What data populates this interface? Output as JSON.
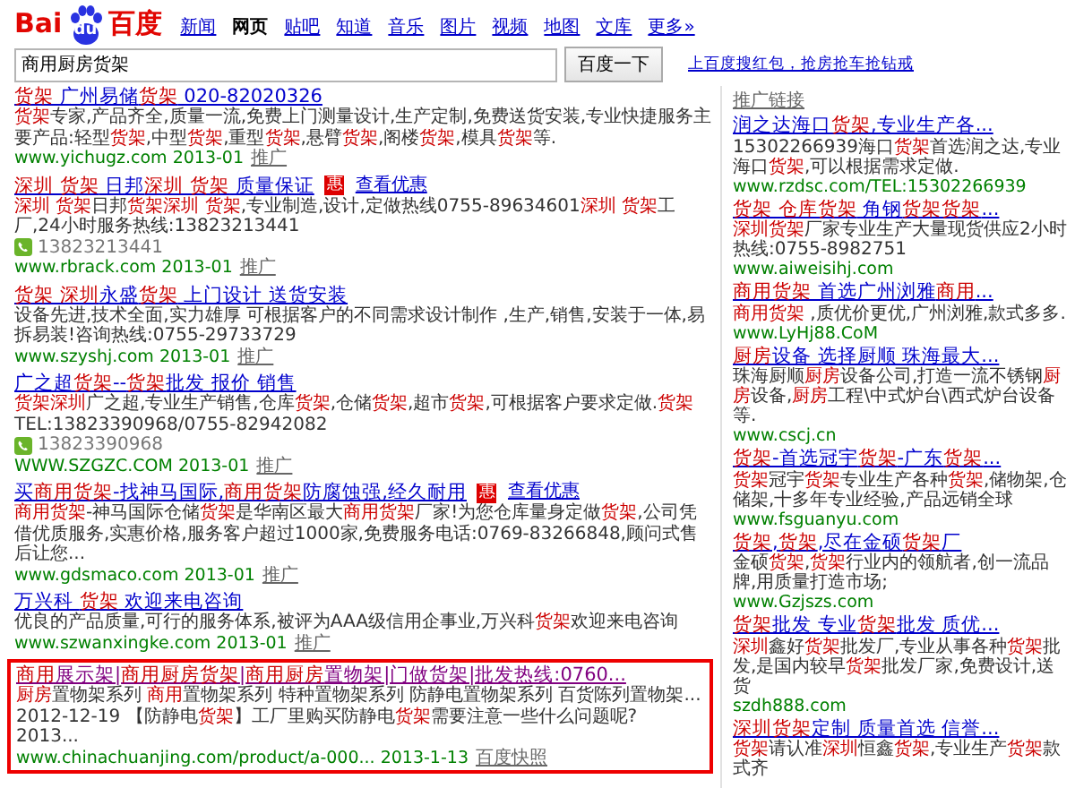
{
  "logo": {
    "left": "Bai",
    "paw": "du",
    "right": "百度"
  },
  "nav": [
    {
      "label": "新闻",
      "selected": false
    },
    {
      "label": "网页",
      "selected": true
    },
    {
      "label": "贴吧",
      "selected": false
    },
    {
      "label": "知道",
      "selected": false
    },
    {
      "label": "音乐",
      "selected": false
    },
    {
      "label": "图片",
      "selected": false
    },
    {
      "label": "视频",
      "selected": false
    },
    {
      "label": "地图",
      "selected": false
    },
    {
      "label": "文库",
      "selected": false
    },
    {
      "label": "更多»",
      "selected": false
    }
  ],
  "search": {
    "value": "商用厨房货架",
    "button": "百度一下",
    "promo": "上百度搜红包，抢房抢车抢钻戒"
  },
  "results": [
    {
      "title": "**货架** 广州易储**货架** 020-82020326",
      "desc": "**货架**专家,产品齐全,质量一流,免费上门测量设计,生产定制,免费送货安装,专业快捷服务主要产品:轻型**货架**,中型**货架**,重型**货架**,悬臂**货架**,阁楼**货架**,模具**货架**等.",
      "url": "www.yichugz.com 2013-01",
      "tag": "推广",
      "visited": false,
      "boxed": false
    },
    {
      "title": "**深圳 货架** 日邦**深圳 货架** 质量保证",
      "offer": {
        "badge": "惠",
        "label": "查看优惠"
      },
      "desc": "**深圳 货架**日邦**货架深圳 货架**,专业制造,设计,定做热线0755-89634601**深圳 货架**工厂,24小时服务热线:13823213441",
      "phone": "13823213441",
      "url": "www.rbrack.com 2013-01",
      "tag": "推广",
      "visited": false,
      "boxed": false
    },
    {
      "title": "**货架 深圳**永盛**货架** 上门设计 送货安装",
      "desc": "设备先进,技术全面,实力雄厚 可根据客户的不同需求设计制作 ,生产,销售,安装于一体,易拆易装!咨询热线:0755-29733729",
      "url": "www.szyshj.com 2013-01",
      "tag": "推广",
      "visited": false,
      "boxed": false
    },
    {
      "title": "广之超**货架**--**货架**批发 报价 销售",
      "desc": "**货架深圳**广之超,专业生产销售,仓库**货架**,仓储**货架**,超市**货架**,可根据客户要求定做.**货架**TEL:13823390968/0755-82942082",
      "phone": "13823390968",
      "url": "WWW.SZGZC.COM 2013-01",
      "tag": "推广",
      "visited": false,
      "boxed": false
    },
    {
      "title": "买**商用货架**-找神马国际,**商用货架**防腐蚀强,经久耐用",
      "offer": {
        "badge": "惠",
        "label": "查看优惠"
      },
      "desc": "**商用货架**-神马国际仓储**货架**是华南区最大**商用货架**厂家!为您仓库量身定做**货架**,公司凭借优质服务,实惠价格,服务客户超过1000家,免费服务电话:0769-83266848,顾问式售后让您...",
      "url": "www.gdsmaco.com 2013-01",
      "tag": "推广",
      "visited": false,
      "boxed": false
    },
    {
      "title": "万兴科 **货架** 欢迎来电咨询",
      "desc": "优良的产品质量,可行的服务体系,被评为AAA级信用企事业,万兴科**货架**欢迎来电咨询",
      "url": "www.szwanxingke.com 2013-01",
      "tag": "推广",
      "visited": false,
      "boxed": false
    },
    {
      "title": "**商用**展示架|**商用厨房货架**|**商用厨房**置物架|门做货架|批发热线:0760...",
      "desc": "**厨房**置物架系列 **商用**置物架系列 特种置物架系列 防静电置物架系列 百货陈列置物架... 2012-12-19 【防静电**货架**】工厂里购买防静电**货架**需要注意一些什么问题呢? 2013...",
      "url": "www.chinachuanjing.com/product/a-000... 2013-1-13",
      "tag": "百度快照",
      "visited": true,
      "boxed": true
    }
  ],
  "side": {
    "heading": "推广链接",
    "items": [
      {
        "title": "润之达海口**货架**,专业生产各...",
        "desc": "15302266939海口**货架**首选润之达,专业海口**货架**,可以根据需求定做.",
        "url": "www.rzdsc.com/TEL:15302266939"
      },
      {
        "title": "**货架 仓库货架** 角钢**货架货架**...",
        "desc": "**深圳货架**厂家专业生产大量现货供应2小时热线:0755-8982751",
        "url": "www.aiweisihj.com"
      },
      {
        "title": "**商用货架** 首选广州浏雅**商用**...",
        "desc": "**商用货架** ,质优价更优,广州浏雅,款式多多.",
        "url": "www.LyHj88.CoM"
      },
      {
        "title": "**厨房**设备 选择厨顺 珠海最大...",
        "desc": "珠海厨顺**厨房**设备公司,打造一流不锈钢**厨房**设备,**厨房**工程\\中式炉台\\西式炉台设备等.",
        "url": "www.cscj.cn"
      },
      {
        "title": "**货架**-首选冠宇**货架**-广东**货架**...",
        "desc": "**货架**冠宇**货架**专业生产各种**货架**,储物架,仓储架,十多年专业经验,产品远销全球",
        "url": "www.fsguanyu.com"
      },
      {
        "title": "**货架**,**货架**,尽在金硕**货架**厂",
        "desc": "金硕**货架**,**货架**行业内的领航者,创一流品牌,用质量打造市场;",
        "url": "www.Gzjszs.com"
      },
      {
        "title": "**货架**批发 专业**货架**批发 质优...",
        "desc": "**深圳**鑫好**货架**批发厂,专业从事各种**货架**批发,是国内较早**货架**批发厂家,免费设计,送货",
        "url": "szdh888.com"
      },
      {
        "title": "**深圳货架**定制 质量首选 信誉...",
        "desc": "**货架**请认准**深圳**恒鑫**货架**,专业生产**货架**款式齐"
      }
    ]
  }
}
